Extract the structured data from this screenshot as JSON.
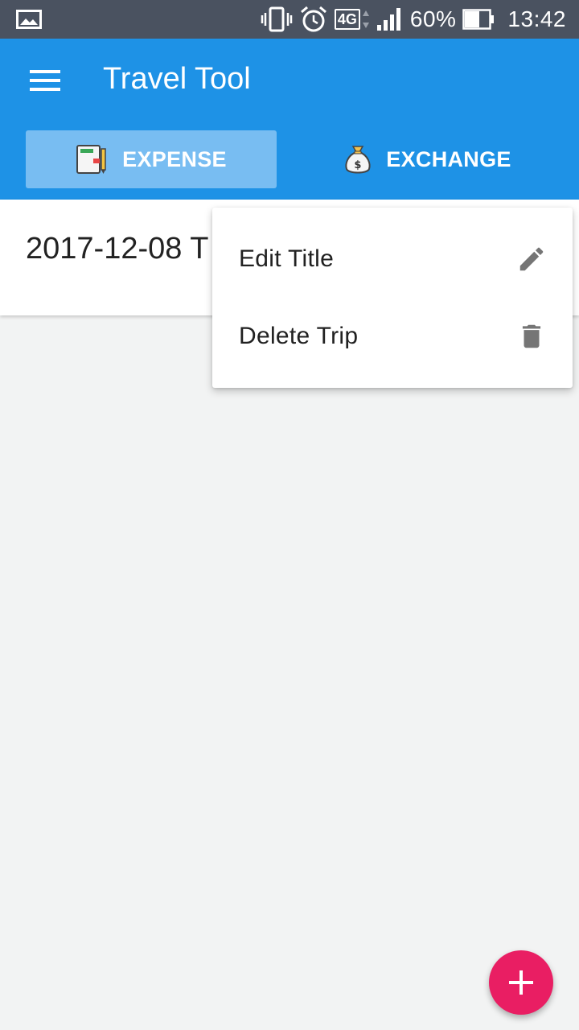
{
  "status_bar": {
    "battery_percent": "60%",
    "time": "13:42",
    "network_type": "4G",
    "icons": [
      "gallery-icon",
      "vibrate-icon",
      "alarm-icon",
      "network-4g-icon",
      "signal-icon",
      "battery-icon"
    ]
  },
  "app_bar": {
    "title": "Travel Tool",
    "menu_icon": "hamburger-menu-icon"
  },
  "tabs": [
    {
      "label": "EXPENSE",
      "icon": "notebook-icon",
      "selected": true
    },
    {
      "label": "EXCHANGE",
      "icon": "money-bag-icon",
      "selected": false
    }
  ],
  "trip_list": {
    "items": [
      {
        "title": "2017-12-08 T"
      }
    ]
  },
  "popup_menu": {
    "items": [
      {
        "label": "Edit Title",
        "icon": "pencil-icon"
      },
      {
        "label": "Delete Trip",
        "icon": "trash-icon"
      }
    ]
  },
  "fab": {
    "icon": "plus-icon"
  },
  "colors": {
    "status_bar": "#4a5260",
    "primary": "#1e92e6",
    "tab_selected": "#78bdf2",
    "background": "#f2f3f3",
    "fab": "#e91e63",
    "menu_icon_gray": "#757575"
  }
}
